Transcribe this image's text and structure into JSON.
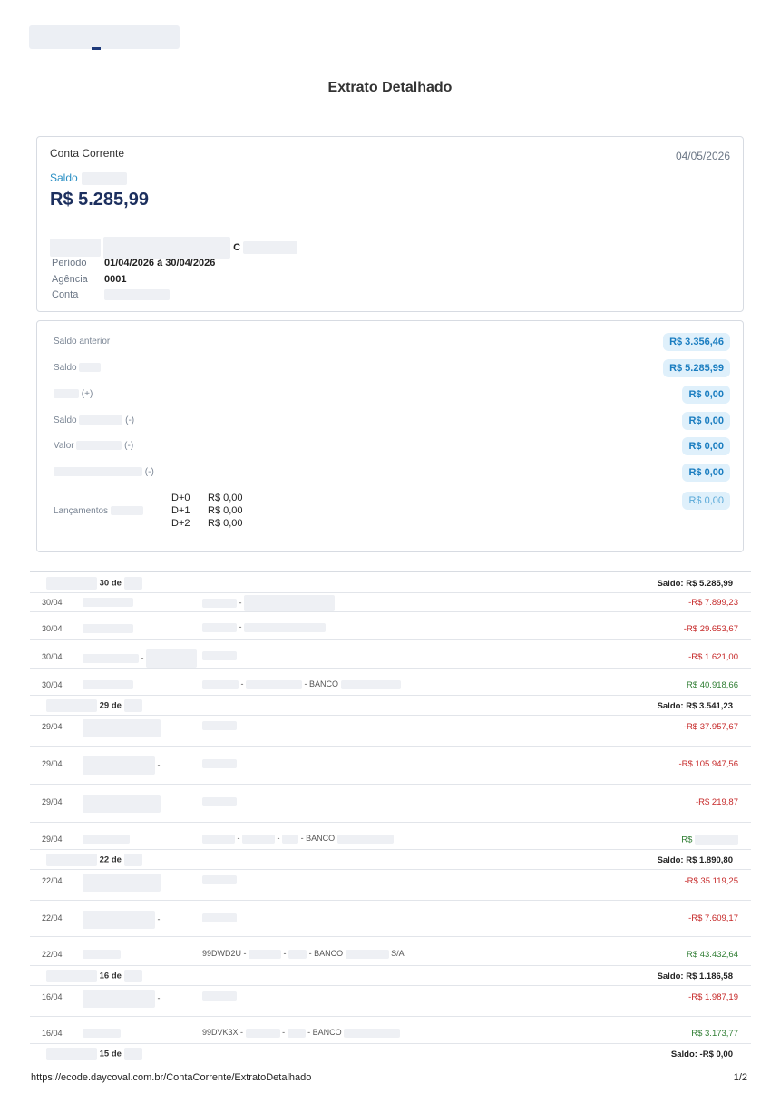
{
  "title": "Extrato Detalhado",
  "account": {
    "type": "Conta Corrente",
    "date": "04/05/2026",
    "saldo_label": "Saldo",
    "balance": "R$ 5.285,99",
    "name_suffix": "C",
    "periodo_label": "Período",
    "periodo": "01/04/2026 à 30/04/2026",
    "agencia_label": "Agência",
    "agencia": "0001",
    "conta_label": "Conta"
  },
  "summary": {
    "rows": [
      {
        "label": "Saldo anterior",
        "value": "R$ 3.356,46"
      },
      {
        "label": "Saldo",
        "value": "R$ 5.285,99"
      },
      {
        "label": "(+)",
        "value": "R$ 0,00"
      },
      {
        "label": "Saldo",
        "suffix": "(-)",
        "value": "R$ 0,00"
      },
      {
        "label": "Valor",
        "suffix": "(-)",
        "value": "R$ 0,00"
      },
      {
        "label": "(-)",
        "value": "R$ 0,00"
      }
    ],
    "lancamentos_label": "Lançamentos",
    "lancamentos_value": "R$ 0,00",
    "schedule": [
      {
        "d": "D+0",
        "v": "R$ 0,00"
      },
      {
        "d": "D+1",
        "v": "R$ 0,00"
      },
      {
        "d": "D+2",
        "v": "R$ 0,00"
      }
    ]
  },
  "groups": [
    {
      "day": "30 de",
      "balance": "Saldo: R$ 5.285,99",
      "rows": [
        {
          "date": "30/04",
          "info_mid": "-",
          "amount": "-R$ 7.899,23",
          "sign": "neg"
        },
        {
          "date": "30/04",
          "info_mid": "-",
          "amount": "-R$ 29.653,67",
          "sign": "neg"
        },
        {
          "date": "30/04",
          "desc_mid": "-",
          "amount": "-R$ 1.621,00",
          "sign": "neg"
        },
        {
          "date": "30/04",
          "info_mid": "-",
          "info_bank": "- BANCO",
          "amount": "R$ 40.918,66",
          "sign": "pos"
        }
      ]
    },
    {
      "day": "29 de",
      "balance": "Saldo: R$ 3.541,23",
      "rows": [
        {
          "date": "29/04",
          "amount": "-R$ 37.957,67",
          "sign": "neg"
        },
        {
          "date": "29/04",
          "desc_mid": "-",
          "amount": "-R$ 105.947,56",
          "sign": "neg"
        },
        {
          "date": "29/04",
          "amount": "-R$ 219,87",
          "sign": "neg"
        },
        {
          "date": "29/04",
          "info_mid": "-",
          "info_mid2": "-",
          "info_bank": "- BANCO",
          "amount": "R$",
          "sign": "pos"
        }
      ]
    },
    {
      "day": "22 de",
      "balance": "Saldo: R$ 1.890,80",
      "rows": [
        {
          "date": "22/04",
          "amount": "-R$ 35.119,25",
          "sign": "neg"
        },
        {
          "date": "22/04",
          "desc_mid": "-",
          "amount": "-R$ 7.609,17",
          "sign": "neg"
        },
        {
          "date": "22/04",
          "info_code": "99DWD2U -",
          "info_mid": "-",
          "info_bank": "- BANCO",
          "info_tail": "S/A",
          "amount": "R$ 43.432,64",
          "sign": "pos"
        }
      ]
    },
    {
      "day": "16 de",
      "balance": "Saldo: R$ 1.186,58",
      "rows": [
        {
          "date": "16/04",
          "desc_mid": "-",
          "amount": "-R$ 1.987,19",
          "sign": "neg"
        },
        {
          "date": "16/04",
          "info_code": "99DVK3X -",
          "info_mid": "-",
          "info_bank": "- BANCO",
          "amount": "R$ 3.173,77",
          "sign": "pos"
        }
      ]
    },
    {
      "day": "15 de",
      "balance": "Saldo: -R$ 0,00",
      "rows": []
    }
  ],
  "footer": {
    "url": "https://ecode.daycoval.com.br/ContaCorrente/ExtratoDetalhado",
    "page": "1/2"
  }
}
